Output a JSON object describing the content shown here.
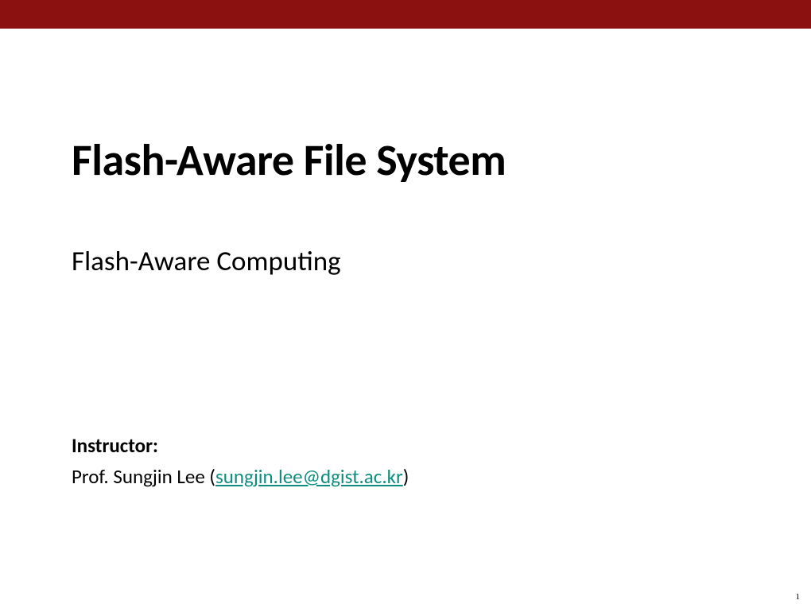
{
  "colors": {
    "accent_bar": "#8b1010",
    "link": "#0e8d7f"
  },
  "slide": {
    "title": "Flash-Aware File System",
    "subtitle": "Flash-Aware Computing",
    "instructor_label": "Instructor:",
    "instructor_prefix": "Prof. Sungjin Lee (",
    "instructor_email": "sungjin.lee@dgist.ac.kr",
    "instructor_suffix": ")",
    "page_number": "1"
  }
}
